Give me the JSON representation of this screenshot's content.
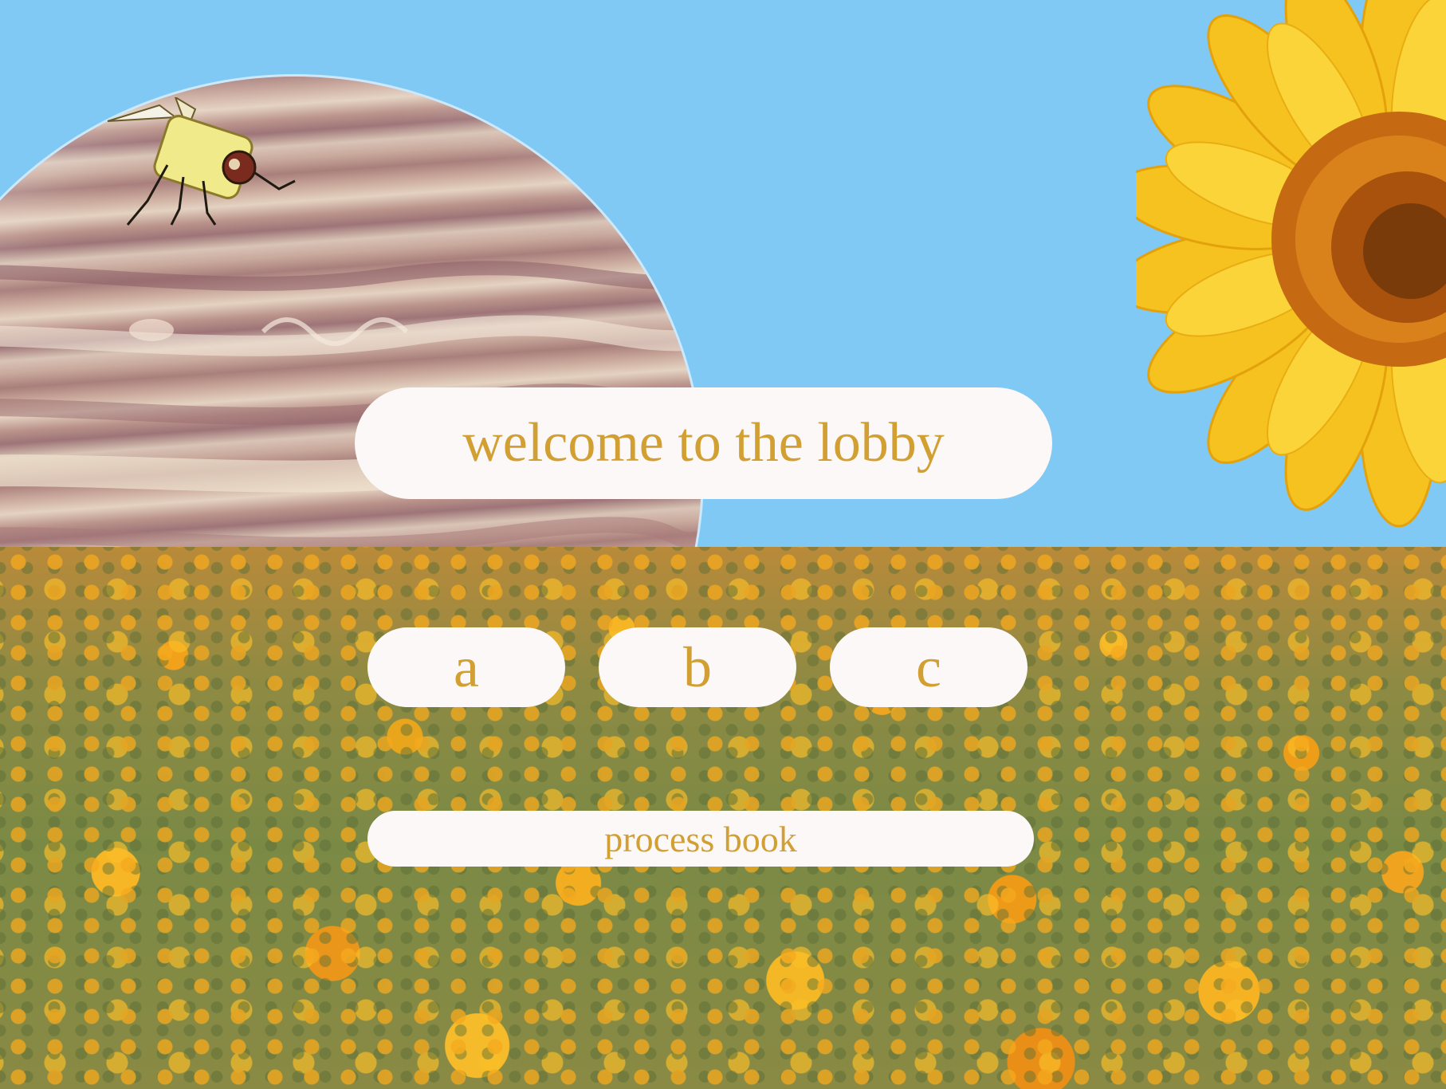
{
  "page": {
    "title": "welcome to the lobby"
  },
  "nav": {
    "items": [
      {
        "label": "a"
      },
      {
        "label": "b"
      },
      {
        "label": "c"
      }
    ],
    "process_book": "process book"
  },
  "colors": {
    "sky": "#81c9f5",
    "pill_background": "#fcf8f7",
    "pill_text": "#d29f33"
  },
  "images": {
    "planet": "jupiter-planet-image",
    "sunflower": "sunflower-image",
    "bee": "bee-image",
    "field": "sunflower-field-image"
  }
}
